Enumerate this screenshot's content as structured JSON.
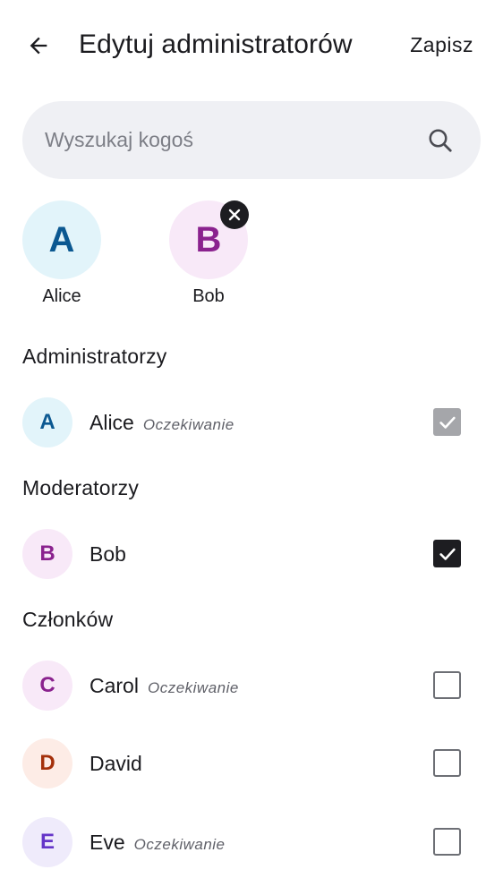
{
  "header": {
    "title": "Edytuj administratorów",
    "save_label": "Zapisz"
  },
  "search": {
    "placeholder": "Wyszukaj kogoś"
  },
  "selected": [
    {
      "initial": "A",
      "name": "Alice",
      "removable": false
    },
    {
      "initial": "B",
      "name": "Bob",
      "removable": true
    }
  ],
  "sections": {
    "admins": {
      "title": "Administratorzy",
      "rows": [
        {
          "initial": "A",
          "name": "Alice",
          "status": "Oczekiwanie",
          "checkbox": "checked-disabled"
        }
      ]
    },
    "moderators": {
      "title": "Moderatorzy",
      "rows": [
        {
          "initial": "B",
          "name": "Bob",
          "status": "",
          "checkbox": "checked"
        }
      ]
    },
    "members": {
      "title": "Członków",
      "rows": [
        {
          "initial": "C",
          "name": "Carol",
          "status": "Oczekiwanie",
          "checkbox": "unchecked"
        },
        {
          "initial": "D",
          "name": "David",
          "status": "",
          "checkbox": "unchecked"
        },
        {
          "initial": "E",
          "name": "Eve",
          "status": "Oczekiwanie",
          "checkbox": "unchecked"
        }
      ]
    }
  },
  "colors": {
    "checkbox_checked": "#1d1d21",
    "checkbox_disabled": "#a5a6aa",
    "search_bg": "#eff0f4"
  },
  "icons": {
    "back": "arrow-left-icon",
    "search": "search-icon",
    "remove": "close-icon",
    "check": "check-icon"
  }
}
